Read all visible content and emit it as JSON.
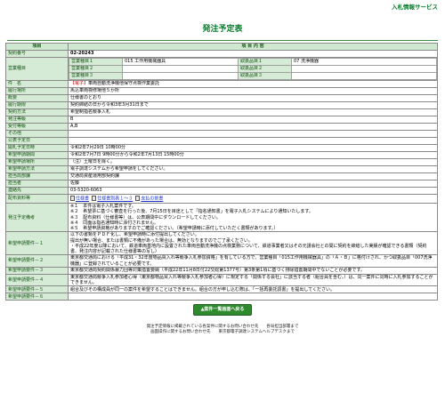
{
  "header": {
    "service_link": "入札情報サービス",
    "title": "発注予定表"
  },
  "table": {
    "col_item": "項目",
    "col_content": "項 目 内 容",
    "contract_no_label": "契約番号",
    "contract_no": "02-20243",
    "business_type_label": "営業種目",
    "business_rows": [
      {
        "l1": "営業種目１",
        "v1": "015 工作用機械器具",
        "l2": "取扱品目１",
        "v2": "07 洗浄機器"
      },
      {
        "l1": "営業種目２",
        "v1": "",
        "l2": "取扱品目２",
        "v2": ""
      },
      {
        "l1": "営業種目３",
        "v1": "",
        "l2": "取扱品目３",
        "v2": ""
      }
    ],
    "subject_label": "件　名",
    "subject_tag": "【電子】",
    "subject": "車両自動洗浄機他保守点検作業委託",
    "location_label": "履行場所",
    "location": "馬込車両検修場他５か所",
    "overview_label": "概要",
    "overview": "仕様書のとおり",
    "period_label": "履行期限",
    "period": "契約締結の日から令和3年3月31日まで",
    "method_label": "契約方法",
    "method": "希望制指名競争入札",
    "grade_label": "発注等級",
    "grade": "B",
    "grade2_label": "受付等級",
    "grade2": "A,B",
    "other_label": "その他",
    "other": "",
    "pubdate_label": "公表予定日",
    "pubdate": "",
    "open_label": "開札予定日時",
    "open": "令和2年7月29日 10時00分",
    "apply_label": "希望申請期間",
    "apply": "令和2年7月7日 9時00分から令和2年7月13日 15時00分",
    "place_label": "希望申請場所",
    "place": "（注）土曜日を除く。",
    "apply_method_label": "希望申請方法",
    "apply_method": "電子調達システムから希望申請をしてください。",
    "dept_label": "担当局部課",
    "dept": "交通局資産運用部契約課",
    "person_label": "担当者",
    "person": "佐藤",
    "tel_label": "連絡先",
    "tel": "03-5320-6063",
    "docs_label": "配布資料等",
    "docs": [
      "仕様書",
      "仕様書別表１～３",
      "支払の前書"
    ],
    "notes_label": "発注予定備考",
    "notes": [
      "※１　本件は電子入札案件です。",
      "※２　希望票に基づく審査を行った後、7月15日を目途として「指名通知書」を電子入札システムにより通知いたします。",
      "※３　配布資料（仕様書等）は、公表期間中にダウンロードしてください。",
      "※４　同面は指名通知時に添付されません。",
      "※５　希望申請資格がありますのでご確認ください。（希望申請時に添付していただく書類があります。）"
    ],
    "req1_label": "希望申請要件－１",
    "req1": "以下の書類をＰＤＦ化し、希望申請時に添付提出してください。\n提出が無い場合、または書類に不備があった場合は、無効となりますのでご了承ください。\n・平成22年度以降において、鉄道車両基地内に設置された車両自動洗浄機の点検業務について、鉄道事業者又はその元請会社との間に契約を締結した実績が確認できる書類（契約書、発注内容が記載された仕様書等の写し）",
    "req2_label": "希望申請要件－２",
    "req2": "東京都交通局における「平成31・32年度物品買入れ等競争入札参加資格」を有している方で、営業種目「015工作用機械器具」の「Ａ・Ｂ」に格付けされ、かつ取扱品目「007洗浄機器」に登録されていることが必要です。",
    "req3_label": "希望申請要件－３",
    "req3": "東京都交通局契約関係暴力団等対策措置要綱（平成22年11月8日付22交総第1377号）第3条第1項に基づく排除措置期間中でないことが必要です。",
    "req4_label": "希望申請要件－４",
    "req4": "東京都交通局競争入札参加者心得（東京都物品買入れ等競争入札参加者心得）に規定する「関係する会社」に該当する者（組合員を含む。）は、同一案件に同時に入札参加することができません。",
    "req5_label": "希望申請要件－５",
    "req5": "組合及びその構成員が同一の案件を希望することはできません。組合の方が申し込む際は、「一括再委託調書」を提出してください。",
    "req6_label": "希望申請要件－６",
    "req6": ""
  },
  "back_button": "▲案件一覧画面へ戻る",
  "footer": {
    "line1": "発注予定情報に掲載されている各案件に関するお問い合わせ先　　各局担当部署まで",
    "line2": "画面操作に関するお問い合わせ先　　東京都電子調達システムヘルプデスクまで"
  }
}
